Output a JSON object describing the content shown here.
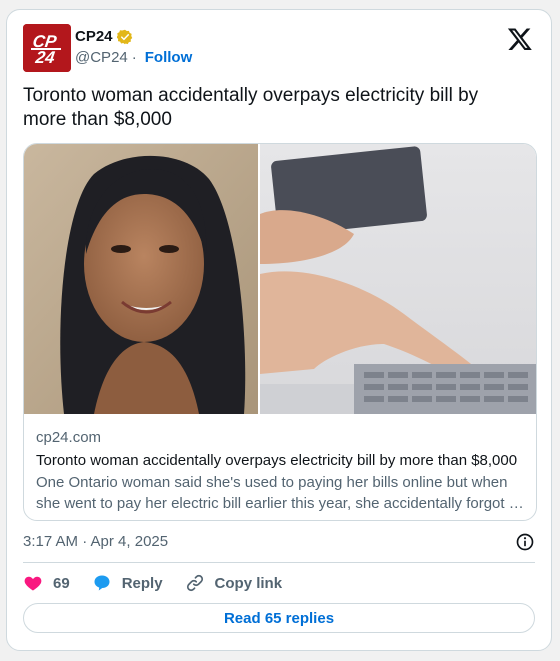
{
  "account": {
    "name": "CP24",
    "handle": "@CP24",
    "separator": "·",
    "follow_label": "Follow",
    "logo_text": "CP24",
    "brand_color": "#b3171c"
  },
  "platform_icon": "x-logo-icon",
  "tweet": {
    "text": "Toronto woman accidentally overpays electricity bill by more than $8,000"
  },
  "link_card": {
    "domain": "cp24.com",
    "title": "Toronto woman accidentally overpays electricity bill by more than $8,000",
    "description": "One Ontario woman said she's used to paying her bills online but when she went to pay her electric bill earlier this year, she accidentally forgot …"
  },
  "timestamp": "3:17 AM · Apr 4, 2025",
  "actions": {
    "like_count": "69",
    "reply_label": "Reply",
    "copy_link_label": "Copy link"
  },
  "read_replies_label": "Read 65 replies",
  "colors": {
    "like": "#f91880",
    "reply": "#1d9bf0",
    "link": "#006fd6",
    "muted": "#536471",
    "verified_gold": "#e2b719"
  }
}
